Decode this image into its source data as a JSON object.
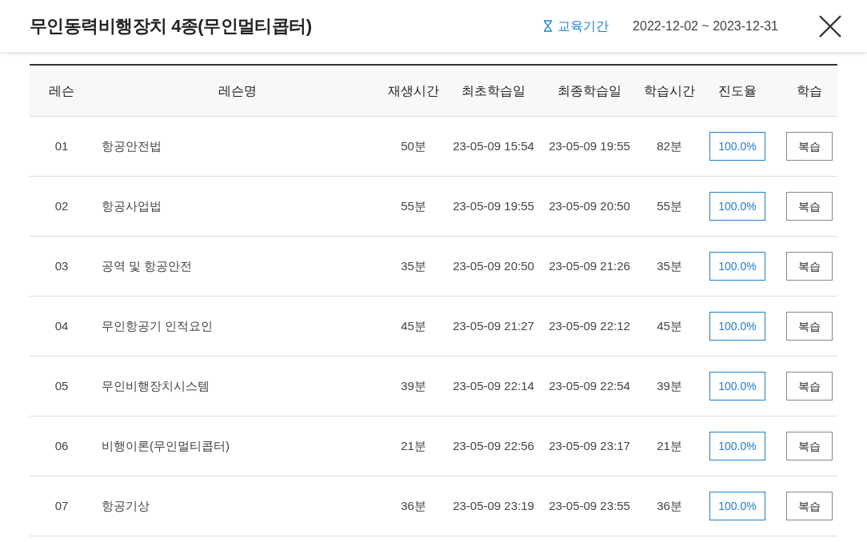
{
  "header": {
    "title": "무인동력비행장치 4종(무인멀티콥터)",
    "period_label": "교육기간",
    "period": "2022-12-02 ~ 2023-12-31"
  },
  "table": {
    "columns": [
      "레슨",
      "레슨명",
      "재생시간",
      "최초학습일",
      "최종학습일",
      "학습시간",
      "진도율",
      "학습"
    ],
    "rows": [
      {
        "lesson": "01",
        "name": "항공안전법",
        "play_time": "50분",
        "first": "23-05-09 15:54",
        "last": "23-05-09 19:55",
        "study_time": "82분",
        "progress": "100.0%",
        "action": "복습"
      },
      {
        "lesson": "02",
        "name": "항공사업법",
        "play_time": "55분",
        "first": "23-05-09 19:55",
        "last": "23-05-09 20:50",
        "study_time": "55분",
        "progress": "100.0%",
        "action": "복습"
      },
      {
        "lesson": "03",
        "name": "공역 및 항공안전",
        "play_time": "35분",
        "first": "23-05-09 20:50",
        "last": "23-05-09 21:26",
        "study_time": "35분",
        "progress": "100.0%",
        "action": "복습"
      },
      {
        "lesson": "04",
        "name": "무인항공기 인적요인",
        "play_time": "45분",
        "first": "23-05-09 21:27",
        "last": "23-05-09 22:12",
        "study_time": "45분",
        "progress": "100.0%",
        "action": "복습"
      },
      {
        "lesson": "05",
        "name": "무인비행장치시스템",
        "play_time": "39분",
        "first": "23-05-09 22:14",
        "last": "23-05-09 22:54",
        "study_time": "39분",
        "progress": "100.0%",
        "action": "복습"
      },
      {
        "lesson": "06",
        "name": "비행이론(무인멀티콥터)",
        "play_time": "21분",
        "first": "23-05-09 22:56",
        "last": "23-05-09 23:17",
        "study_time": "21분",
        "progress": "100.0%",
        "action": "복습"
      },
      {
        "lesson": "07",
        "name": "항공기상",
        "play_time": "36분",
        "first": "23-05-09 23:19",
        "last": "23-05-09 23:55",
        "study_time": "36분",
        "progress": "100.0%",
        "action": "복습"
      }
    ]
  }
}
